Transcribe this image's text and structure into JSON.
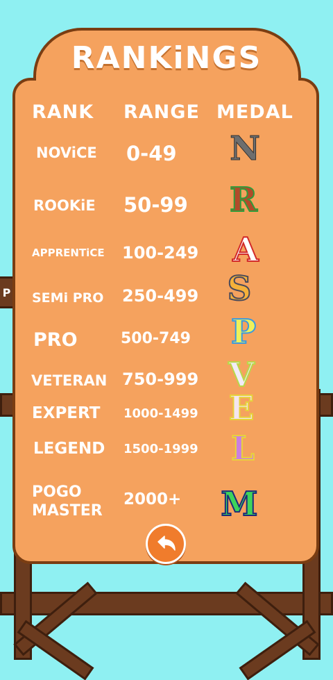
{
  "title": "RANKiNGS",
  "headers": {
    "rank": "RANK",
    "range": "RANGE",
    "medal": "MEDAL"
  },
  "side_tab": "P",
  "rows": [
    {
      "rank": "NOViCE",
      "range": "0-49",
      "medal": "N"
    },
    {
      "rank": "ROOKiE",
      "range": "50-99",
      "medal": "R"
    },
    {
      "rank": "APPRENTiCE",
      "range": "100-249",
      "medal": "A"
    },
    {
      "rank": "SEMi PRO",
      "range": "250-499",
      "medal": "S"
    },
    {
      "rank": "PRO",
      "range": "500-749",
      "medal": "P"
    },
    {
      "rank": "VETERAN",
      "range": "750-999",
      "medal": "V"
    },
    {
      "rank": "EXPERT",
      "range": "1000-1499",
      "medal": "E"
    },
    {
      "rank": "LEGEND",
      "range": "1500-1999",
      "medal": "L"
    },
    {
      "rank": "POGO MASTER",
      "range": "2000+",
      "medal": "M"
    }
  ],
  "colors": {
    "sky": "#8ff0f2",
    "board": "#f5a25e",
    "board_border": "#7a3d12",
    "wood": "#6b3b1f",
    "back_button": "#f07c2c",
    "medal_N": "#7a7a7a",
    "medal_R": "#b24a2a",
    "medal_A": "#ffffff",
    "medal_S": "#f5b13a",
    "medal_P": "#eef25a",
    "medal_V": "#f2ecf8",
    "medal_E": "#f4e6f0",
    "medal_L": "#c97fe0",
    "medal_M": "#3fd45a"
  },
  "icons": {
    "back_button": "undo-arrow-icon"
  }
}
